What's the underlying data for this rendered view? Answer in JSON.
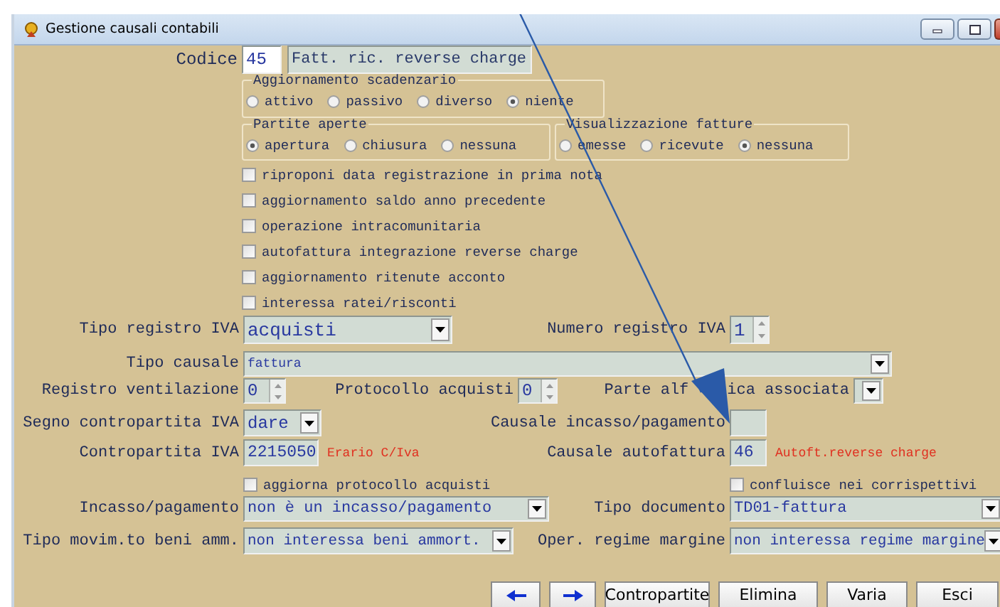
{
  "window": {
    "title": "Gestione causali contabili"
  },
  "codice": {
    "label": "Codice",
    "value": "45",
    "description": "Fatt. ric. reverse charge"
  },
  "radio_groups": [
    {
      "title": "Aggiornamento scadenzario",
      "options": [
        {
          "label": "attivo",
          "selected": false
        },
        {
          "label": "passivo",
          "selected": false
        },
        {
          "label": "diverso",
          "selected": false
        },
        {
          "label": "niente",
          "selected": true
        }
      ]
    },
    {
      "title": "Partite aperte",
      "options": [
        {
          "label": "apertura",
          "selected": true
        },
        {
          "label": "chiusura",
          "selected": false
        },
        {
          "label": "nessuna",
          "selected": false
        }
      ]
    },
    {
      "title": "Visualizzazione fatture",
      "options": [
        {
          "label": "emesse",
          "selected": false
        },
        {
          "label": "ricevute",
          "selected": false
        },
        {
          "label": "nessuna",
          "selected": true
        }
      ]
    }
  ],
  "options": [
    {
      "label": "riproponi data registrazione in prima nota",
      "checked": false
    },
    {
      "label": "aggiornamento saldo anno precedente",
      "checked": false
    },
    {
      "label": "operazione intracomunitaria",
      "checked": false
    },
    {
      "label": "autofattura integrazione reverse charge",
      "checked": false
    },
    {
      "label": "aggiornamento ritenute acconto",
      "checked": false
    },
    {
      "label": "interessa ratei/risconti",
      "checked": false
    }
  ],
  "rows": [
    {
      "fields": [
        {
          "kind": "dropdown",
          "label": "Tipo registro IVA",
          "value": "acquisti"
        },
        {
          "kind": "spinner",
          "label": "Numero registro IVA",
          "value": "1"
        }
      ]
    },
    {
      "fields": [
        {
          "kind": "dropdown",
          "label": "Tipo causale",
          "value": "fattura"
        }
      ]
    },
    {
      "fields": [
        {
          "kind": "spinner",
          "label": "Registro ventilazione",
          "value": "0"
        },
        {
          "kind": "spinner",
          "label": "Protocollo acquisti",
          "value": "0"
        },
        {
          "kind": "dropdown",
          "label_parts": [
            "Parte alf",
            "ica associata"
          ]
        }
      ]
    },
    {
      "fields": [
        {
          "kind": "dropdown",
          "label": "Segno contropartita IVA",
          "value": "dare"
        },
        {
          "kind": "text",
          "label": "Causale incasso/pagamento"
        }
      ]
    },
    {
      "fields": [
        {
          "kind": "text",
          "label": "Contropartita IVA",
          "value": "2215050",
          "note": "Erario C/Iva"
        },
        {
          "kind": "text",
          "label": "Causale autofattura",
          "value": "46",
          "note": "Autoft.reverse charge"
        }
      ]
    },
    {
      "fields": [
        {
          "kind": "checkbox",
          "label": "aggiorna protocollo acquisti",
          "checked": false
        },
        {
          "kind": "checkbox",
          "label": "confluisce nei corrispettivi",
          "checked": false
        }
      ]
    },
    {
      "fields": [
        {
          "kind": "dropdown",
          "label": "Incasso/pagamento",
          "value": "non è un incasso/pagamento"
        },
        {
          "kind": "dropdown",
          "label": "Tipo documento",
          "value": "TD01-fattura"
        }
      ]
    },
    {
      "fields": [
        {
          "kind": "dropdown",
          "label": "Tipo movim.to beni amm.",
          "value": "non interessa beni ammort."
        },
        {
          "kind": "dropdown",
          "label": "Oper. regime margine",
          "value": "non interessa regime margine"
        }
      ]
    }
  ],
  "buttons": [
    {
      "kind": "back"
    },
    {
      "kind": "forward"
    },
    {
      "kind": "text",
      "label": "Contropartite"
    },
    {
      "kind": "text",
      "label": "Elimina"
    },
    {
      "kind": "text",
      "label": "Varia"
    },
    {
      "kind": "text",
      "label": "Esci"
    }
  ]
}
